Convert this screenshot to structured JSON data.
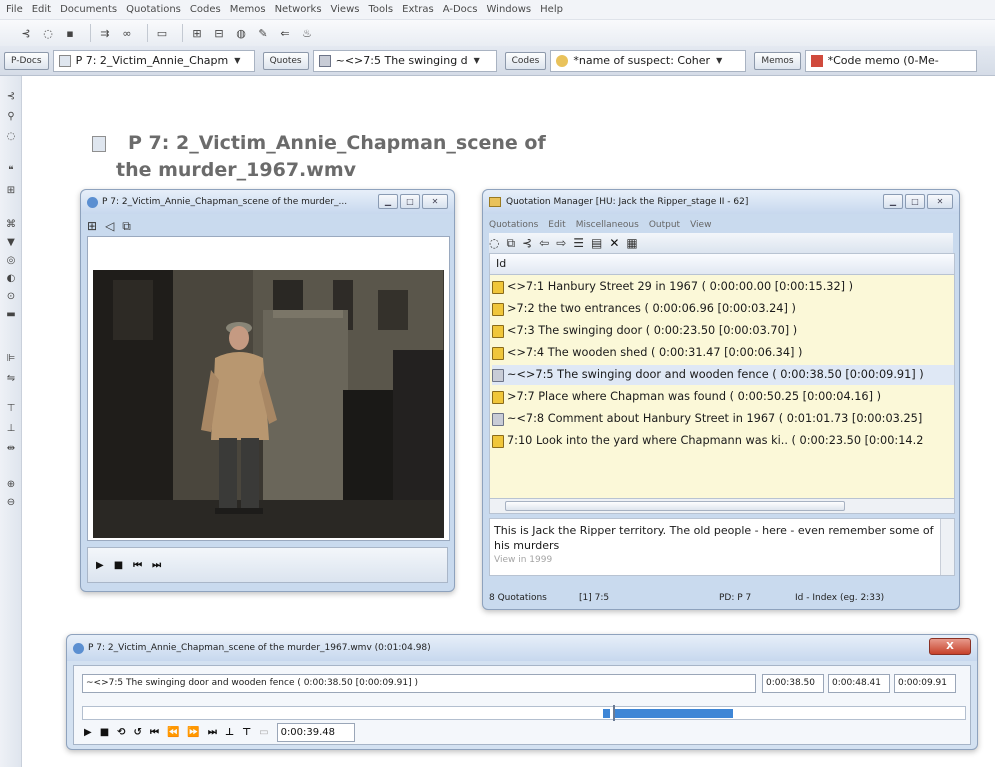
{
  "menubar": [
    "File",
    "Edit",
    "Documents",
    "Quotations",
    "Codes",
    "Memos",
    "Networks",
    "Views",
    "Tools",
    "Extras",
    "A-Docs",
    "Windows",
    "Help"
  ],
  "selectors": {
    "pdocs_label": "P-Docs",
    "pdocs_value": "P 7: 2_Victim_Annie_Chapm",
    "quotes_label": "Quotes",
    "quotes_value": "~<>7:5 The swinging d",
    "codes_label": "Codes",
    "codes_value": "*name of suspect: Coher",
    "memos_label": "Memos",
    "memos_value": "*Code memo (0-Me-"
  },
  "document": {
    "title_line1": "P 7: 2_Victim_Annie_Chapman_scene of",
    "title_line2": "the murder_1967.wmv"
  },
  "video_window": {
    "title": "P 7: 2_Victim_Annie_Chapman_scene of the murder_..."
  },
  "quotation_manager": {
    "title": "Quotation Manager [HU: Jack the Ripper_stage II - 62]",
    "menu": [
      "Quotations",
      "Edit",
      "Miscellaneous",
      "Output",
      "View"
    ],
    "column_header": "Id",
    "rows": [
      "<>7:1 Hanbury Street 29 in 1967 ( 0:00:00.00 [0:00:15.32] )",
      ">7:2 the two entrances ( 0:00:06.96 [0:00:03.24] )",
      "<7:3 The swinging door ( 0:00:23.50 [0:00:03.70] )",
      "<>7:4 The wooden shed ( 0:00:31.47 [0:00:06.34] )",
      "~<>7:5 The swinging door and wooden fence ( 0:00:38.50 [0:00:09.91] )",
      ">7:7 Place where Chapman was found ( 0:00:50.25 [0:00:04.16] )",
      "~<7:8 Comment about Hanbury Street in 1967 ( 0:01:01.73 [0:00:03.25]",
      "7:10 Look into the yard where Chapmann was ki.. ( 0:00:23.50 [0:00:14.2"
    ],
    "comment_text": "This is Jack the Ripper territory. The old people - here - even remember some of his murders",
    "comment_faded": "View in 1999",
    "status": {
      "count": "8 Quotations",
      "selected": "[1] 7:5",
      "pd": "PD: P 7",
      "index": "Id - Index (eg. 2:33)"
    }
  },
  "player_window": {
    "title": "P 7: 2_Victim_Annie_Chapman_scene of the murder_1967.wmv (0:01:04.98)",
    "close_label": "X",
    "quotation_field": "~<>7:5 The swinging door and wooden fence ( 0:00:38.50 [0:00:09.91] )",
    "time_start": "0:00:38.50",
    "time_end": "0:00:48.41",
    "time_length": "0:00:09.91",
    "position": "0:00:39.48"
  },
  "colors": {
    "list_background": "#fbf8d8",
    "selection": "#dfe8f5",
    "track_segment": "#3e86d6"
  }
}
